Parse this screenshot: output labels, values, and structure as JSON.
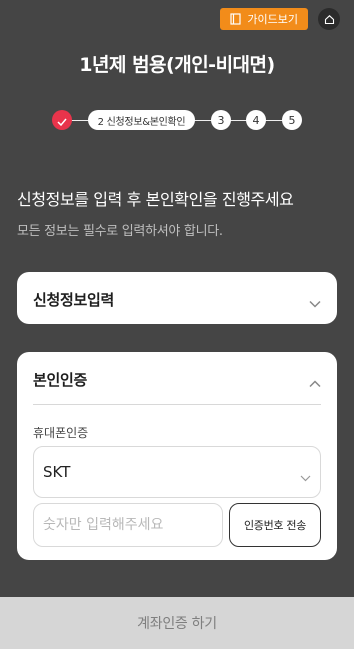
{
  "header": {
    "guide_label": "가이드보기",
    "guide_icon": "book-icon",
    "home_icon": "home-icon",
    "title": "1년제 범용(개인-비대면)"
  },
  "progress": {
    "done_icon": "check-icon",
    "current_label": "2 신청정보&본인확인",
    "steps": [
      "3",
      "4",
      "5"
    ]
  },
  "intro": {
    "headline": "신청정보를 입력 후 본인확인을 진행주세요",
    "subline": "모든 정보는 필수로 입력하셔야 합니다."
  },
  "application_section": {
    "title": "신청정보입력",
    "state": "collapsed"
  },
  "verification_section": {
    "title": "본인인증",
    "state": "expanded",
    "phone_label": "휴대폰인증",
    "carrier_value": "SKT",
    "number_placeholder": "숫자만 입력해주세요",
    "send_code_label": "인증번호 전송"
  },
  "footer": {
    "account_verify_label": "계좌인증 하기"
  },
  "colors": {
    "background": "#454545",
    "accent": "#f28c1a",
    "step_done": "#e8344b"
  }
}
